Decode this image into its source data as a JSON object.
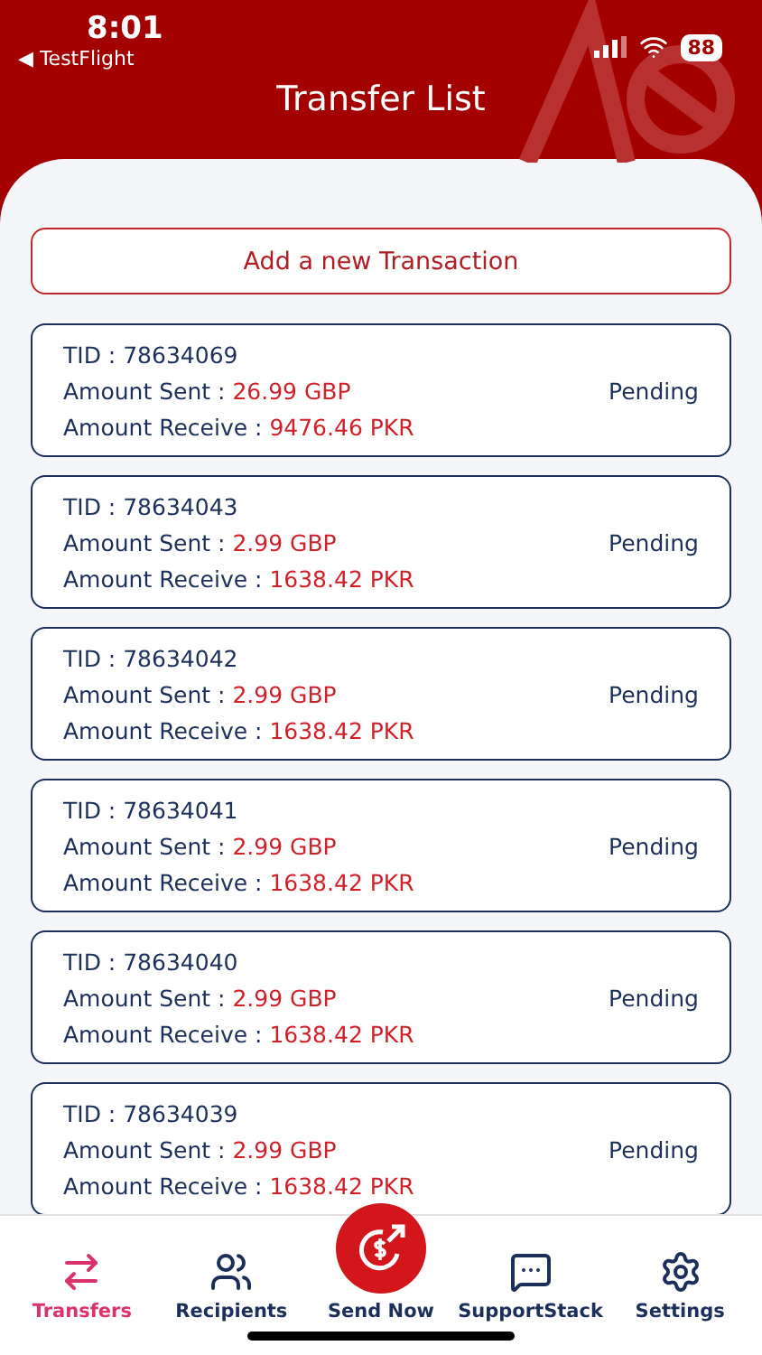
{
  "status_bar": {
    "time": "8:01",
    "back_label": "◀ TestFlight",
    "battery": "88"
  },
  "header": {
    "title": "Transfer List"
  },
  "add_button": "Add a new Transaction",
  "transactions": [
    {
      "tid_label": "TID : ",
      "tid": "78634069",
      "sent_label": "Amount Sent : ",
      "sent": "26.99 GBP",
      "receive_label": "Amount Receive : ",
      "receive": "9476.46 PKR",
      "status": "Pending"
    },
    {
      "tid_label": "TID : ",
      "tid": "78634043",
      "sent_label": "Amount Sent : ",
      "sent": "2.99 GBP",
      "receive_label": "Amount Receive : ",
      "receive": "1638.42 PKR",
      "status": "Pending"
    },
    {
      "tid_label": "TID : ",
      "tid": "78634042",
      "sent_label": "Amount Sent : ",
      "sent": "2.99 GBP",
      "receive_label": "Amount Receive : ",
      "receive": "1638.42 PKR",
      "status": "Pending"
    },
    {
      "tid_label": "TID : ",
      "tid": "78634041",
      "sent_label": "Amount Sent : ",
      "sent": "2.99 GBP",
      "receive_label": "Amount Receive : ",
      "receive": "1638.42 PKR",
      "status": "Pending"
    },
    {
      "tid_label": "TID : ",
      "tid": "78634040",
      "sent_label": "Amount Sent : ",
      "sent": "2.99 GBP",
      "receive_label": "Amount Receive : ",
      "receive": "1638.42 PKR",
      "status": "Pending"
    },
    {
      "tid_label": "TID : ",
      "tid": "78634039",
      "sent_label": "Amount Sent : ",
      "sent": "2.99 GBP",
      "receive_label": "Amount Receive : ",
      "receive": "1638.42 PKR",
      "status": "Pending"
    }
  ],
  "tab_bar": [
    {
      "label": "Transfers",
      "kind": "transfers",
      "selected": true
    },
    {
      "label": "Recipients",
      "kind": "recipients",
      "selected": false
    },
    {
      "label": "Send Now",
      "kind": "send",
      "selected": false
    },
    {
      "label": "SupportStack",
      "kind": "support",
      "selected": false
    },
    {
      "label": "Settings",
      "kind": "settings",
      "selected": false
    }
  ]
}
